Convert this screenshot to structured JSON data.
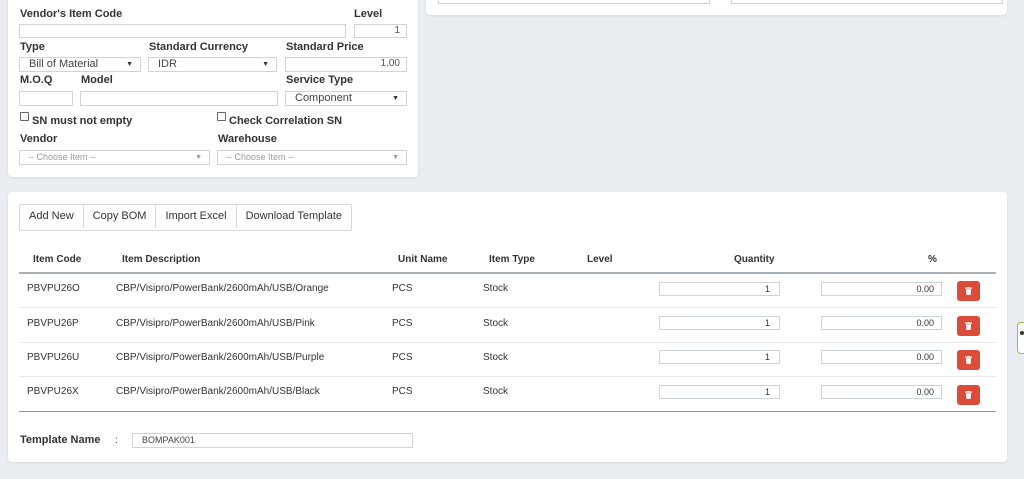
{
  "item_form": {
    "vendor_item_code_label": "Vendor's Item Code",
    "vendor_item_code_value": "",
    "level_label": "Level",
    "level_value": "1",
    "type_label": "Type",
    "type_value": "Bill of Material",
    "currency_label": "Standard Currency",
    "currency_value": "IDR",
    "standard_price_label": "Standard Price",
    "standard_price_value": "1.00",
    "moq_label": "M.O.Q",
    "moq_value": "",
    "model_label": "Model",
    "model_value": "",
    "service_type_label": "Service Type",
    "service_type_value": "Component",
    "sn_not_empty_label": "SN must not empty",
    "check_correlation_label": "Check Correlation SN",
    "vendor_label": "Vendor",
    "vendor_placeholder": "-- Choose Item --",
    "warehouse_label": "Warehouse",
    "warehouse_placeholder": "-- Choose Item --"
  },
  "toolbar": {
    "add_new": "Add New",
    "copy_bom": "Copy BOM",
    "import_excel": "Import Excel",
    "download_template": "Download Template"
  },
  "table": {
    "headers": {
      "item_code": "Item Code",
      "item_description": "Item Description",
      "unit_name": "Unit Name",
      "item_type": "Item Type",
      "level": "Level",
      "quantity": "Quantity",
      "percent": "%"
    },
    "rows": [
      {
        "item_code": "PBVPU26O",
        "description": "CBP/Visipro/PowerBank/2600mAh/USB/Orange",
        "unit": "PCS",
        "type": "Stock",
        "level": "",
        "quantity": "1",
        "percent": "0.00"
      },
      {
        "item_code": "PBVPU26P",
        "description": "CBP/Visipro/PowerBank/2600mAh/USB/Pink",
        "unit": "PCS",
        "type": "Stock",
        "level": "",
        "quantity": "1",
        "percent": "0.00"
      },
      {
        "item_code": "PBVPU26U",
        "description": "CBP/Visipro/PowerBank/2600mAh/USB/Purple",
        "unit": "PCS",
        "type": "Stock",
        "level": "",
        "quantity": "1",
        "percent": "0.00"
      },
      {
        "item_code": "PBVPU26X",
        "description": "CBP/Visipro/PowerBank/2600mAh/USB/Black",
        "unit": "PCS",
        "type": "Stock",
        "level": "",
        "quantity": "1",
        "percent": "0.00"
      }
    ]
  },
  "template": {
    "label": "Template Name",
    "separator": ":",
    "value": "BOMPAK001"
  },
  "colors": {
    "background": "#e9ecf1",
    "delete_button": "#dd4b39"
  },
  "icons": [
    "caret-down-icon",
    "trash-icon"
  ]
}
